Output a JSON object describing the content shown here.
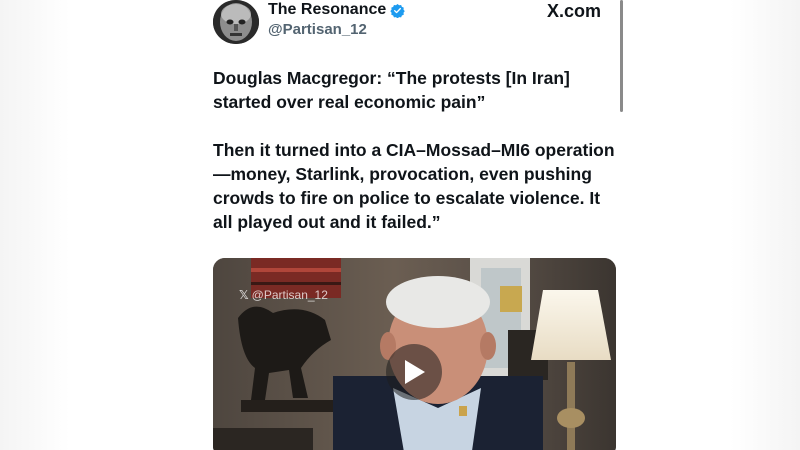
{
  "tweet": {
    "display_name": "The Resonance",
    "handle": "@Partisan_12",
    "brand": "X.com",
    "verified_color": "#1d9bf0",
    "paragraphs": [
      "Douglas Macgregor: “The protests [In Iran] started over real economic pain”",
      "Then it turned into a CIA–Mossad–MI6 operation—money, Starlink, provocation, even pushing crowds to fire on police to escalate violence. It all played out and it failed.”"
    ]
  },
  "media": {
    "watermark": "@Partisan_12",
    "type": "video"
  },
  "icons": {
    "verified": "verified-badge-icon",
    "play": "play-icon",
    "x_logo": "x-logo-icon"
  }
}
